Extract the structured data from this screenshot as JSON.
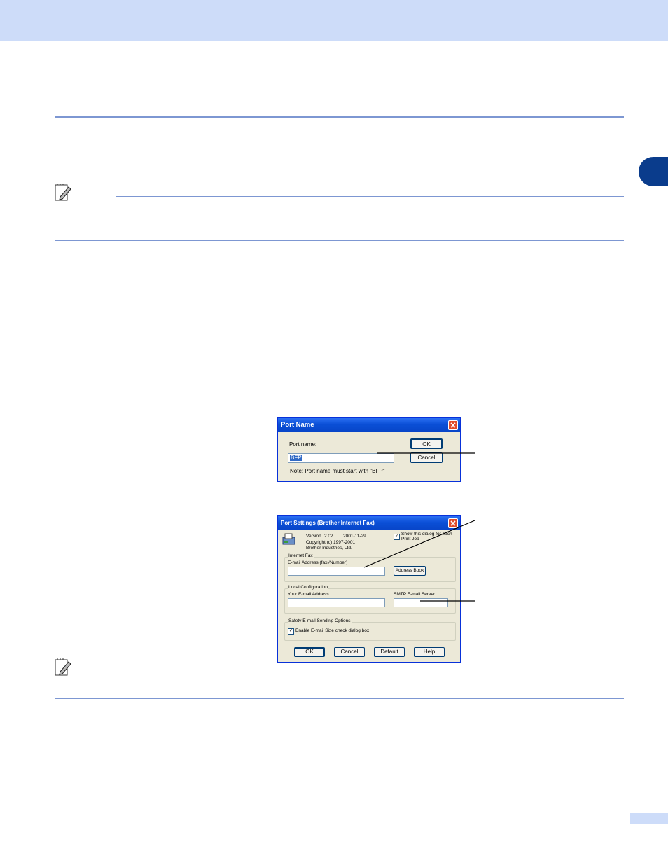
{
  "colors": {
    "header_band": "#cddcf9",
    "rule": "#4f6fb0",
    "chapter_tab": "#0a3c8c",
    "dialog_titlebar": "#0a4fd6",
    "dialog_body": "#ece9d8"
  },
  "note_icons": [
    "note-pencil-icon",
    "note-pencil-icon"
  ],
  "port_name_dialog": {
    "title": "Port Name",
    "port_name_label": "Port name:",
    "port_name_value": "BFP",
    "note": "Note: Port name must start with \"BFP\"",
    "ok": "OK",
    "cancel": "Cancel"
  },
  "port_settings_dialog": {
    "title": "Port Settings (Brother Internet Fax)",
    "version_label": "Version",
    "version": "2.02",
    "date": "2001-11-29",
    "copyright": "Copyright (c) 1997-2001",
    "company": "Brother Industries, Ltd.",
    "show_dialog": "Show this dialog for each Print Job",
    "show_dialog_checked": "✓",
    "internet_fax_group": "Internet Fax",
    "email_address_label": "E-mail Address (fax#Number)",
    "email_address_value": "",
    "address_book": "Address Book",
    "local_config_group": "Local Configuration",
    "your_email_label": "Your E-mail Address",
    "your_email_value": "",
    "smtp_label": "SMTP E-mail Server",
    "smtp_value": "",
    "safety_group": "Safety E-mail Sending Options",
    "enable_size_check": "Enable E-mail Size check dialog box",
    "enable_size_check_checked": "✓",
    "ok": "OK",
    "cancel": "Cancel",
    "default": "Default",
    "help": "Help"
  }
}
